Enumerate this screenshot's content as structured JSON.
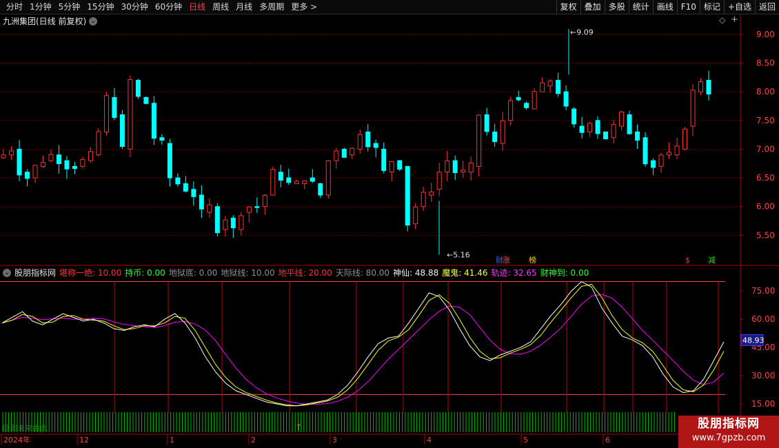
{
  "toolbar": {
    "periods": [
      "分时",
      "1分钟",
      "5分钟",
      "15分钟",
      "30分钟",
      "60分钟",
      "日线",
      "周线",
      "月线",
      "多周期",
      "更多 >"
    ],
    "active_period": "日线",
    "tools": [
      "复权",
      "叠加",
      "多股",
      "统计",
      "画线",
      "F10",
      "标记",
      "+自选",
      "返回"
    ]
  },
  "main_title": "九洲集团(日线 前复权)",
  "price_axis": [
    "9.00",
    "8.50",
    "8.00",
    "7.50",
    "7.00",
    "6.50",
    "6.00",
    "5.50"
  ],
  "price_markers": {
    "high": "9.09",
    "low": "5.16"
  },
  "event_badges": [
    "财",
    "涨",
    "榜",
    "$",
    "减"
  ],
  "indicator": {
    "name": "股朋指标网",
    "items": [
      {
        "label": "堪称一绝:",
        "value": "10.00",
        "color": "#ff3333"
      },
      {
        "label": "持币:",
        "value": "0.00",
        "color": "#33ff33"
      },
      {
        "label": "地狱底:",
        "value": "0.00",
        "color": "#909090"
      },
      {
        "label": "地狱线:",
        "value": "10.00",
        "color": "#909090"
      },
      {
        "label": "地平线:",
        "value": "20.00",
        "color": "#ff3333"
      },
      {
        "label": "天际线:",
        "value": "80.00",
        "color": "#909090"
      },
      {
        "label": "神仙:",
        "value": "48.88",
        "color": "#f0f0f0"
      },
      {
        "label": "魔鬼:",
        "value": "41.46",
        "color": "#ffff33"
      },
      {
        "label": "轨迹:",
        "value": "32.65",
        "color": "#ff33ff"
      },
      {
        "label": "财神到:",
        "value": "0.00",
        "color": "#33ff33"
      }
    ],
    "axis": [
      "75.00",
      "60.00",
      "45.00",
      "30.00",
      "15.00"
    ],
    "current_value": "48.93"
  },
  "time_axis": [
    "2024年",
    "12",
    "1",
    "2",
    "3",
    "4",
    "5",
    "6"
  ],
  "stripe_text": "目到未来由此",
  "watermark": {
    "line1": "股朋指标网",
    "line2": "www.7gpzb.com"
  },
  "colors": {
    "up": "#ff3232",
    "down": "#00ffff",
    "grid": "#8b0000",
    "line_white": "#ffffff",
    "line_yellow": "#ffff00",
    "line_magenta": "#ff00ff",
    "stripe": "#00c000"
  }
}
